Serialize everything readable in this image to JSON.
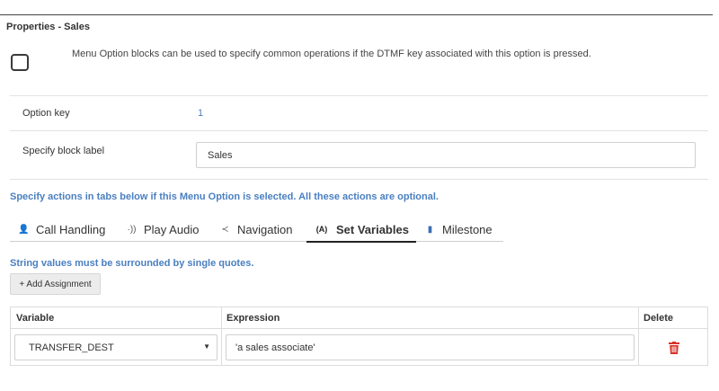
{
  "panel": {
    "title": "Properties - Sales"
  },
  "block": {
    "icon": "square-outline-icon",
    "description": "Menu Option blocks can be used to specify common operations if the DTMF key associated with this option is pressed."
  },
  "option_key": {
    "label": "Option key",
    "value": "1"
  },
  "block_label": {
    "label": "Specify block label",
    "value": "Sales"
  },
  "actions_hint": "Specify actions in tabs below if this Menu Option is selected. All these actions are optional.",
  "tabs": [
    {
      "label": "Call Handling",
      "icon": "person-icon",
      "glyph": "👤",
      "active": false
    },
    {
      "label": "Play Audio",
      "icon": "audio-waves-icon",
      "glyph": "·))",
      "active": false
    },
    {
      "label": "Navigation",
      "icon": "navigation-icon",
      "glyph": "≺",
      "active": false
    },
    {
      "label": "Set Variables",
      "icon": "variable-icon",
      "glyph": "(A)",
      "active": true
    },
    {
      "label": "Milestone",
      "icon": "bookmark-icon",
      "glyph": "▮",
      "active": false
    }
  ],
  "string_hint": "String values must be surrounded by single quotes.",
  "add_button": "+ Add Assignment",
  "table": {
    "headers": {
      "variable": "Variable",
      "expression": "Expression",
      "delete": "Delete"
    },
    "rows": [
      {
        "variable": "TRANSFER_DEST",
        "expression": "'a sales associate'"
      }
    ]
  },
  "colors": {
    "link": "#4a7fc1",
    "delete": "#d9342b",
    "border": "#d0d0d0"
  }
}
